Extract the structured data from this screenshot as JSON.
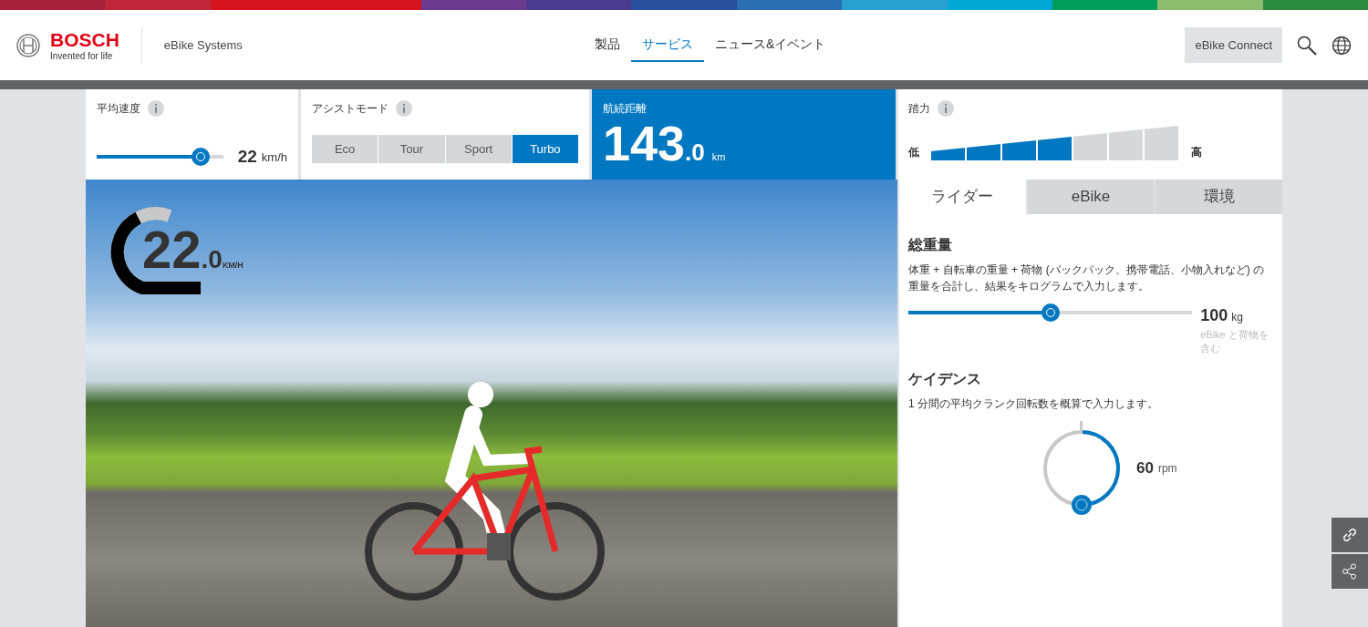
{
  "header": {
    "brand": "BOSCH",
    "tagline": "Invented for life",
    "site": "eBike Systems",
    "nav": [
      {
        "label": "製品",
        "selected": false
      },
      {
        "label": "サービス",
        "selected": true
      },
      {
        "label": "ニュース&イベント",
        "selected": false
      }
    ],
    "connect_button": "eBike Connect"
  },
  "speed": {
    "label": "平均速度",
    "level": 0.82,
    "value": "22",
    "unit": "km/h"
  },
  "assist": {
    "label": "アシストモード",
    "modes": [
      {
        "label": "Eco",
        "selected": false
      },
      {
        "label": "Tour",
        "selected": false
      },
      {
        "label": "Sport",
        "selected": false
      },
      {
        "label": "Turbo",
        "selected": true
      }
    ]
  },
  "range": {
    "label": "航続距離",
    "value": "143",
    "decimal": ".0",
    "unit": "km"
  },
  "pedal_force": {
    "label": "踏力",
    "low": "低",
    "high": "高",
    "level": 0.57
  },
  "speedometer": {
    "value": "22",
    "decimal": ".0",
    "unit": "KM/H"
  },
  "tabs": [
    {
      "label": "ライダー",
      "selected": true
    },
    {
      "label": "eBike",
      "selected": false
    },
    {
      "label": "環境",
      "selected": false
    }
  ],
  "weight": {
    "title": "総重量",
    "description": "体重 + 自転車の重量 + 荷物 (バックパック、携帯電話、小物入れなど) の重量を合計し、結果をキログラムで入力します。",
    "level": 0.5,
    "value": "100",
    "unit": "kg",
    "note": "eBike と荷物を含む"
  },
  "cadence": {
    "title": "ケイデンス",
    "description": "1 分間の平均クランク回転数を概算で入力します。",
    "level": 0.5,
    "value": "60",
    "unit": "rpm"
  }
}
